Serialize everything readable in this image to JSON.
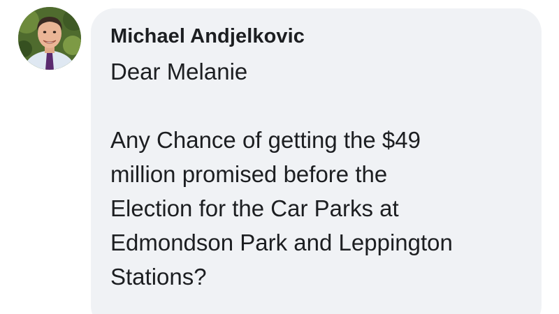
{
  "comment": {
    "author": {
      "name": "Michael Andjelkovic",
      "avatar_icon": "profile-photo"
    },
    "greeting": "Dear Melanie",
    "body_lines": [
      "Any Chance of getting the $49",
      "million promised before the",
      "Election for the Car Parks at",
      "Edmondson Park and Leppington",
      "Stations?"
    ]
  },
  "colors": {
    "bubble_background": "#f0f2f5",
    "text": "#1c1e21",
    "page_background": "#ffffff"
  }
}
